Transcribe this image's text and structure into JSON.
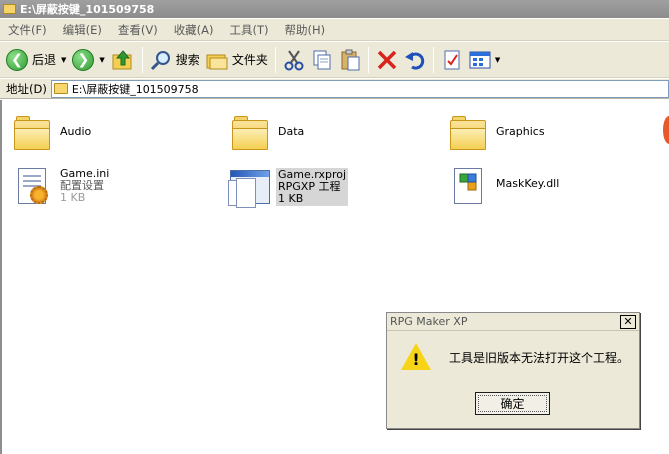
{
  "window": {
    "title": "E:\\屏蔽按键_101509758"
  },
  "menu": [
    "文件(F)",
    "编辑(E)",
    "查看(V)",
    "收藏(A)",
    "工具(T)",
    "帮助(H)"
  ],
  "toolbar": {
    "back_label": "后退",
    "search_label": "搜索",
    "folders_label": "文件夹",
    "icons": [
      "back-icon",
      "forward-icon",
      "up-folder-icon",
      "search-icon",
      "folders-icon",
      "cut-icon",
      "copy-icon",
      "paste-icon",
      "delete-icon",
      "undo-icon",
      "properties-icon",
      "views-icon"
    ]
  },
  "address": {
    "label": "地址(D)",
    "value": "E:\\屏蔽按键_101509758"
  },
  "files": [
    {
      "name": "Audio",
      "type": "folder"
    },
    {
      "name": "Data",
      "type": "folder"
    },
    {
      "name": "Graphics",
      "type": "folder"
    },
    {
      "name": "Game.ini",
      "sub": "配置设置",
      "size": "1 KB",
      "type": "ini"
    },
    {
      "name": "Game.rxproj",
      "sub": "RPGXP 工程",
      "size": "1 KB",
      "type": "rxproj",
      "selected": true
    },
    {
      "name": "MaskKey.dll",
      "type": "dll"
    }
  ],
  "dialog": {
    "title": "RPG Maker XP",
    "message": "工具是旧版本无法打开这个工程。",
    "ok_label": "确定",
    "icon": "warning-icon"
  },
  "colors": {
    "warning": "#f7d417",
    "folder": "#f4cf52",
    "titlebar": "#9a9a9a"
  }
}
